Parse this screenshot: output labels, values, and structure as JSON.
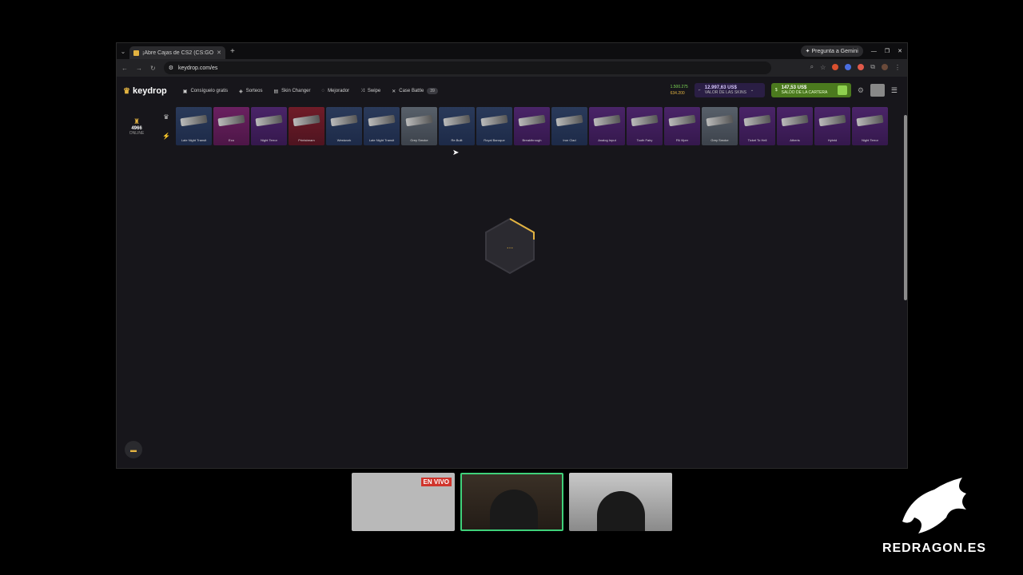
{
  "browser": {
    "tab_title": "¡Abre Cajas de CS2 (CS:GO), Ga",
    "new_tab": "+",
    "gemini_label": "Pregunta a Gemini",
    "url": "keydrop.com/es"
  },
  "site": {
    "logo": "keydrop",
    "nav": [
      {
        "label": "Consíguelo gratis"
      },
      {
        "label": "Sorteos"
      },
      {
        "label": "Skin Changer"
      },
      {
        "label": "Mejorador"
      },
      {
        "label": "Swipe"
      },
      {
        "label": "Case Battle",
        "badge": "39"
      }
    ],
    "coins": {
      "gold": "1.500.275",
      "silver": "634.200"
    },
    "skins_value": {
      "amount": "12.997,63 US$",
      "label": "VALOR DE LAS SKINS"
    },
    "wallet": {
      "amount": "147,53 US$",
      "label": "SALDO DE LA CARTERA"
    },
    "online": {
      "count": "4966",
      "label": "ONLINE"
    },
    "drops": [
      {
        "name": "Late Night Transit",
        "rarity": "blue"
      },
      {
        "name": "Eco",
        "rarity": "pink"
      },
      {
        "name": "Night Terror",
        "rarity": "purple"
      },
      {
        "name": "Printstream",
        "rarity": "red"
      },
      {
        "name": "Westwork",
        "rarity": "blue"
      },
      {
        "name": "Late Night Transit",
        "rarity": "blue"
      },
      {
        "name": "Grey Smoke",
        "rarity": "grey"
      },
      {
        "name": "Re.Built",
        "rarity": "blue"
      },
      {
        "name": "Royal Baroque",
        "rarity": "blue"
      },
      {
        "name": "Breakthrough",
        "rarity": "purple"
      },
      {
        "name": "Iron Clad",
        "rarity": "blue"
      },
      {
        "name": "Analog Input",
        "rarity": "purple"
      },
      {
        "name": "Tooth Fairy",
        "rarity": "purple"
      },
      {
        "name": "PA Viper",
        "rarity": "purple"
      },
      {
        "name": "Grey Smoke",
        "rarity": "grey"
      },
      {
        "name": "Ticket To Hell",
        "rarity": "purple"
      },
      {
        "name": "Atheris",
        "rarity": "purple"
      },
      {
        "name": "Hybrid",
        "rarity": "purple"
      },
      {
        "name": "Night Terror",
        "rarity": "purple"
      }
    ],
    "loader_text": "..."
  },
  "stream": {
    "live_label": "EN VIVO",
    "brand": "REDRAGON.ES"
  },
  "colors": {
    "accent": "#e3b341",
    "wallet_green": "#4b7a1e",
    "skins_purple": "#2a1e44",
    "live_red": "#d0342c"
  }
}
